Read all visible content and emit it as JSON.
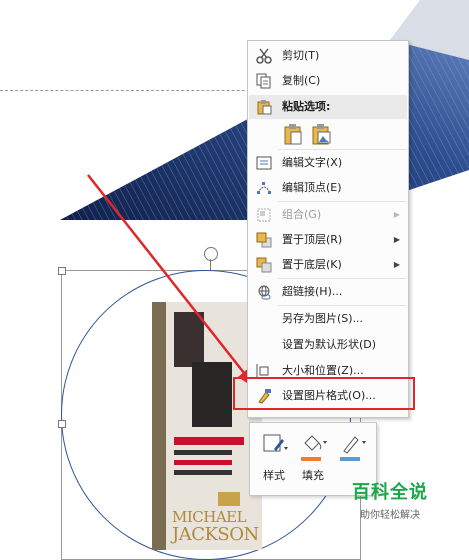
{
  "context_menu": {
    "items": [
      {
        "label": "剪切(T)",
        "icon": "scissors-icon",
        "enabled": true,
        "submenu": false
      },
      {
        "label": "复制(C)",
        "icon": "copy-icon",
        "enabled": true,
        "submenu": false
      },
      {
        "label": "编辑文字(X)",
        "icon": "edit-text-icon",
        "enabled": true,
        "submenu": false
      },
      {
        "label": "编辑顶点(E)",
        "icon": "edit-points-icon",
        "enabled": true,
        "submenu": false
      },
      {
        "label": "组合(G)",
        "icon": "group-icon",
        "enabled": false,
        "submenu": true
      },
      {
        "label": "置于顶层(R)",
        "icon": "bring-to-front-icon",
        "enabled": true,
        "submenu": true
      },
      {
        "label": "置于底层(K)",
        "icon": "send-to-back-icon",
        "enabled": true,
        "submenu": true
      },
      {
        "label": "超链接(H)...",
        "icon": "hyperlink-icon",
        "enabled": true,
        "submenu": false
      },
      {
        "label": "另存为图片(S)...",
        "icon": "",
        "enabled": true,
        "submenu": false
      },
      {
        "label": "设置为默认形状(D)",
        "icon": "",
        "enabled": true,
        "submenu": false
      },
      {
        "label": "大小和位置(Z)...",
        "icon": "size-position-icon",
        "enabled": true,
        "submenu": false
      },
      {
        "label": "设置图片格式(O)...",
        "icon": "format-picture-icon",
        "enabled": true,
        "submenu": false,
        "highlighted": true
      }
    ],
    "paste_options_label": "粘贴选项:",
    "paste_buttons": [
      "paste-keep-source-icon",
      "paste-picture-icon"
    ]
  },
  "mini_toolbar": {
    "buttons": [
      {
        "label": "样式",
        "icon": "style-icon",
        "accent": "#2f5597"
      },
      {
        "label": "填充",
        "icon": "fill-bucket-icon",
        "accent": "#ed7d31"
      },
      {
        "label": "",
        "icon": "outline-pen-icon",
        "accent": "#5b9bd5"
      }
    ]
  },
  "book_cover": {
    "title_line1": "MICHAEL",
    "title_line2": "JACKSON"
  },
  "watermark": {
    "main": "百科全说",
    "sub": "助你轻松解决"
  },
  "colors": {
    "highlight_border": "#e0262a",
    "arrow": "#e0262a",
    "watermark_green": "#1aa64a"
  }
}
